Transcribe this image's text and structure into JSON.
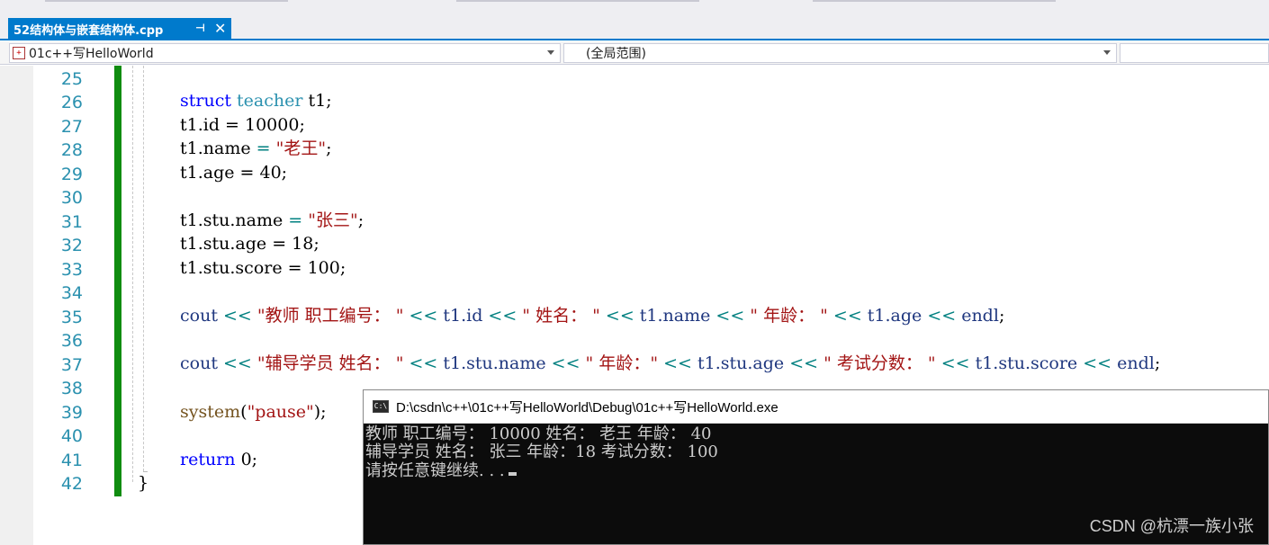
{
  "tab": {
    "title": "52结构体与嵌套结构体.cpp",
    "pin_glyph": "⊣",
    "close_glyph": "✕"
  },
  "navbar": {
    "project": "01c++写HelloWorld",
    "scope": "(全局范围)"
  },
  "line_numbers": [
    "25",
    "26",
    "27",
    "28",
    "29",
    "30",
    "31",
    "32",
    "33",
    "34",
    "35",
    "36",
    "37",
    "38",
    "39",
    "40",
    "41",
    "42"
  ],
  "code": {
    "l26": {
      "kw": "struct",
      "type": "teacher",
      "rest": " t1;"
    },
    "l27": {
      "text": "t1.id = 10000;"
    },
    "l28": {
      "a": "t1.name ",
      "op": "=",
      "b": " ",
      "str": "\"老王\"",
      "c": ";"
    },
    "l29": {
      "text": "t1.age = 40;"
    },
    "l31": {
      "a": "t1.stu.name ",
      "op": "=",
      "b": " ",
      "str": "\"张三\"",
      "c": ";"
    },
    "l32": {
      "text": "t1.stu.age = 18;"
    },
    "l33": {
      "text": "t1.stu.score = 100;"
    },
    "l35": {
      "cout": "cout",
      "op1": " << ",
      "s1": "\"教师 职工编号： \"",
      "op2": " << ",
      "v1": "t1.id",
      "op3": " << ",
      "s2": "\" 姓名： \"",
      "op4": " << ",
      "v2": "t1.name",
      "op5": " << ",
      "s3": "\" 年龄： \"",
      "op6": " << ",
      "v3": "t1.age",
      "op7": " << ",
      "endl": "endl",
      "end": ";"
    },
    "l37": {
      "cout": "cout",
      "op1": " << ",
      "s1": "\"辅导学员 姓名： \"",
      "op2": " << ",
      "v1": "t1.stu.name",
      "op3": " << ",
      "s2": "\" 年龄：\"",
      "op4": " << ",
      "v2": "t1.stu.age",
      "op5": " << ",
      "s3": "\" 考试分数： \"",
      "op6": " << ",
      "v3": "t1.stu.score",
      "op7": " << ",
      "endl": "endl",
      "end": ";"
    },
    "l39": {
      "fn": "system",
      "p1": "(",
      "str": "\"pause\"",
      "p2": ");"
    },
    "l41": {
      "kw": "return",
      "rest": " 0;"
    },
    "l42": {
      "text": "}"
    }
  },
  "console": {
    "title": "D:\\csdn\\c++\\01c++写HelloWorld\\Debug\\01c++写HelloWorld.exe",
    "icon_text": "C:\\",
    "lines": [
      "教师 职工编号： 10000 姓名： 老王 年龄： 40",
      "辅导学员 姓名： 张三 年龄：18 考试分数： 100",
      "请按任意键继续. . ."
    ]
  },
  "watermark": "CSDN @杭漂一族小张",
  "colors": {
    "accent": "#007acc",
    "keyword": "#0000ff",
    "type": "#2b91af",
    "string": "#a31515",
    "change_bar": "#108c10",
    "console_bg": "#0c0c0c"
  }
}
